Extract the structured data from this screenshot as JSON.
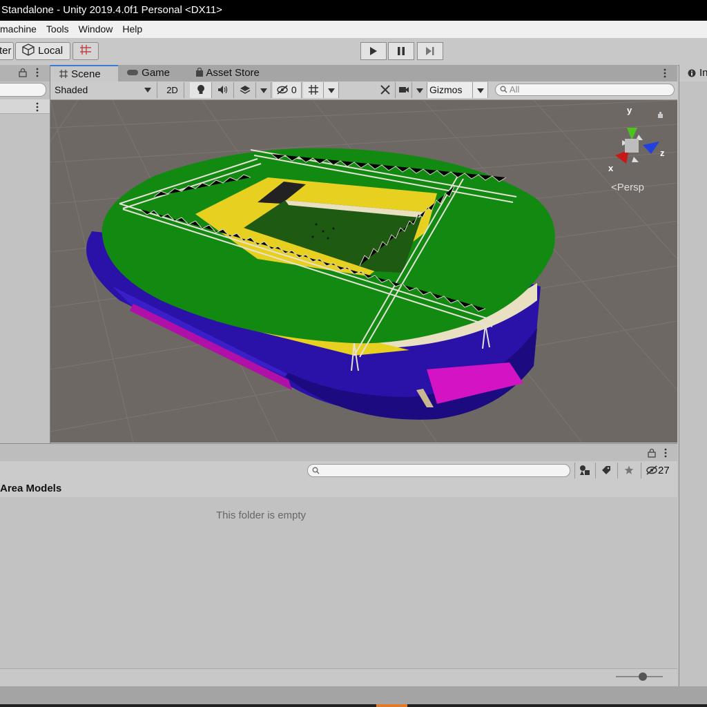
{
  "window": {
    "title": "Standalone - Unity 2019.4.0f1 Personal <DX11>"
  },
  "menu": {
    "items": [
      "machine",
      "Tools",
      "Window",
      "Help"
    ]
  },
  "toolbar": {
    "pivot_partial": "ter",
    "local_label": "Local"
  },
  "tabs": {
    "scene": "Scene",
    "game": "Game",
    "asset_store": "Asset Store",
    "inspector_partial": "In"
  },
  "scene_toolbar": {
    "shading": "Shaded",
    "mode_2d": "2D",
    "hidden_count": "0",
    "gizmos": "Gizmos",
    "search_placeholder": "All"
  },
  "scene_view": {
    "projection": "Persp",
    "axis_x": "x",
    "axis_y": "y",
    "axis_z": "z"
  },
  "project": {
    "breadcrumb": "Area Models",
    "empty_message": "This folder is empty",
    "hidden_count": "27"
  },
  "colors": {
    "roof_green": "#128a12",
    "stand_blue": "#3214b8",
    "accent_magenta": "#d414c4",
    "seat_yellow": "#e8d020",
    "pitch_green": "#1e5a12"
  }
}
